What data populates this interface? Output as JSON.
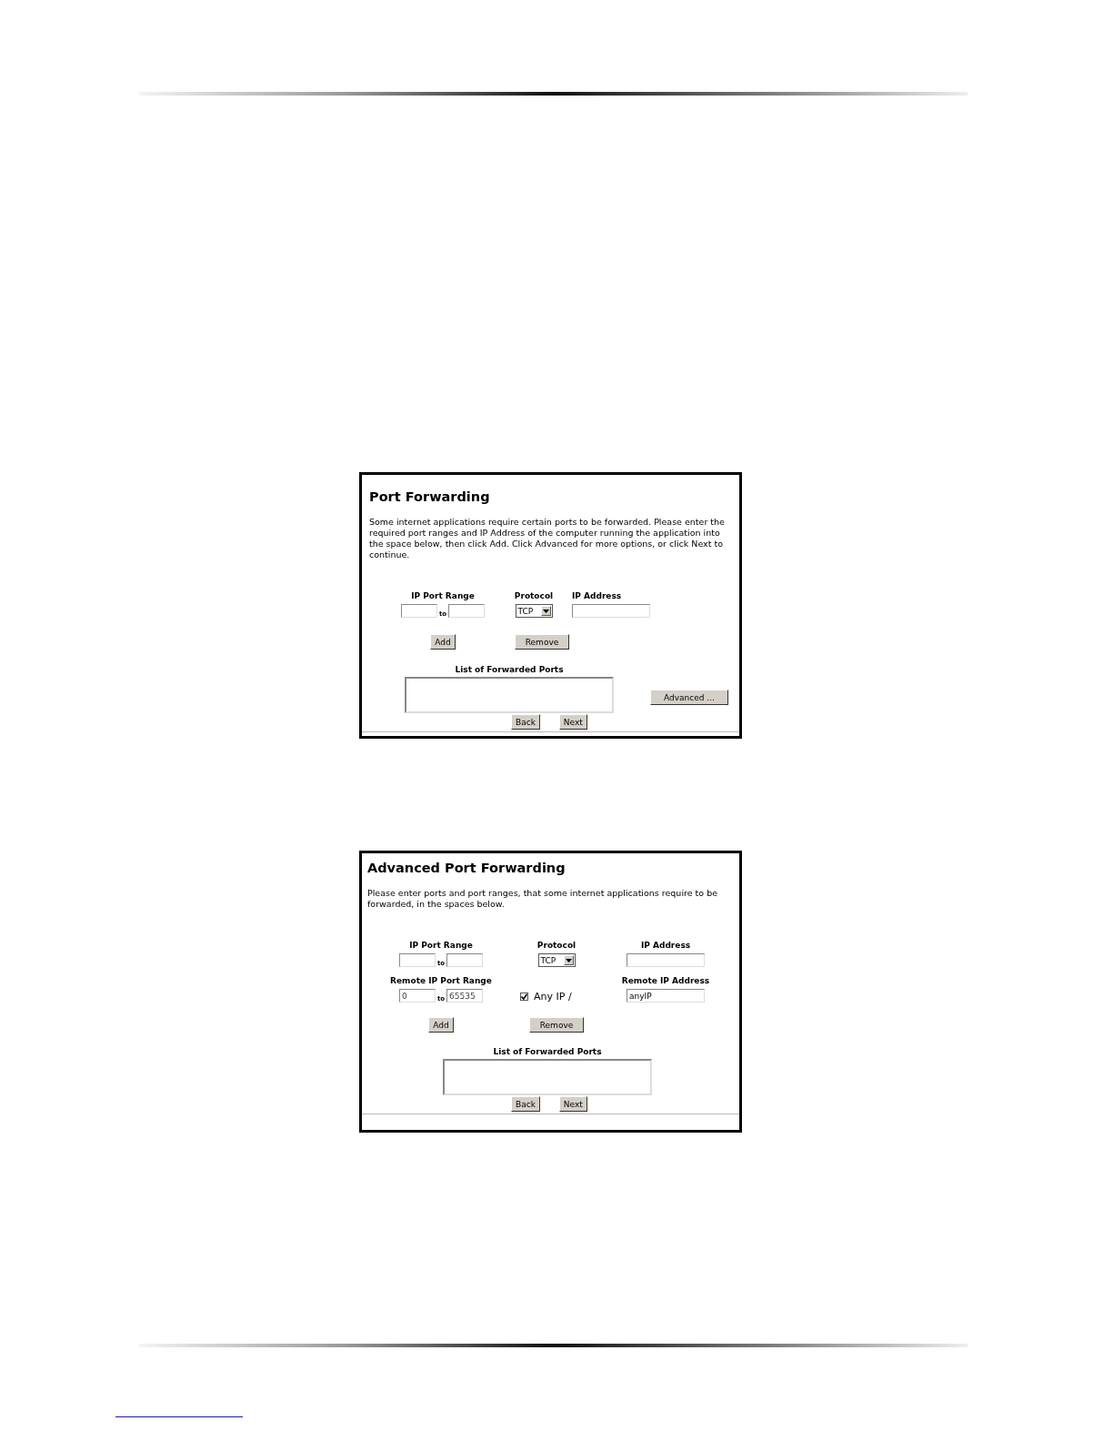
{
  "panels": [
    {
      "kind": "basic",
      "title": "Port Forwarding",
      "description": "Some internet applications require certain ports to be forwarded. Please enter the required port ranges and IP Address of the computer running the application into the space below, then click Add. Click Advanced for more options, or click Next to continue.",
      "field_rows": [
        [
          {
            "kind": "range",
            "label": "IP Port Range",
            "separator": "to"
          },
          {
            "kind": "select",
            "label": "Protocol",
            "value": "TCP"
          },
          {
            "kind": "text",
            "label": "IP Address"
          }
        ]
      ],
      "actions": [
        "Add",
        "Remove"
      ],
      "list": {
        "label": "List of Forwarded Ports"
      },
      "side_button": "Advanced ...",
      "nav": [
        "Back",
        "Next"
      ]
    },
    {
      "kind": "advanced",
      "title": "Advanced Port Forwarding",
      "description": "Please enter ports and port ranges, that some internet applications require to be forwarded, in the spaces below.",
      "field_rows": [
        [
          {
            "kind": "range",
            "label": "IP Port Range",
            "separator": "to"
          },
          {
            "kind": "select",
            "label": "Protocol",
            "value": "TCP"
          },
          {
            "kind": "text",
            "label": "IP Address"
          }
        ],
        [
          {
            "kind": "range",
            "label": "Remote IP Port Range",
            "separator": "to",
            "from_value": "0",
            "to_value": "65535"
          },
          {
            "kind": "checkbox",
            "label": "Any IP /",
            "checked": true
          },
          {
            "kind": "text",
            "label": "Remote IP Address",
            "value": "anyIP"
          }
        ]
      ],
      "actions": [
        "Add",
        "Remove"
      ],
      "list": {
        "label": "List of Forwarded Ports"
      },
      "nav": [
        "Back",
        "Next"
      ]
    }
  ]
}
